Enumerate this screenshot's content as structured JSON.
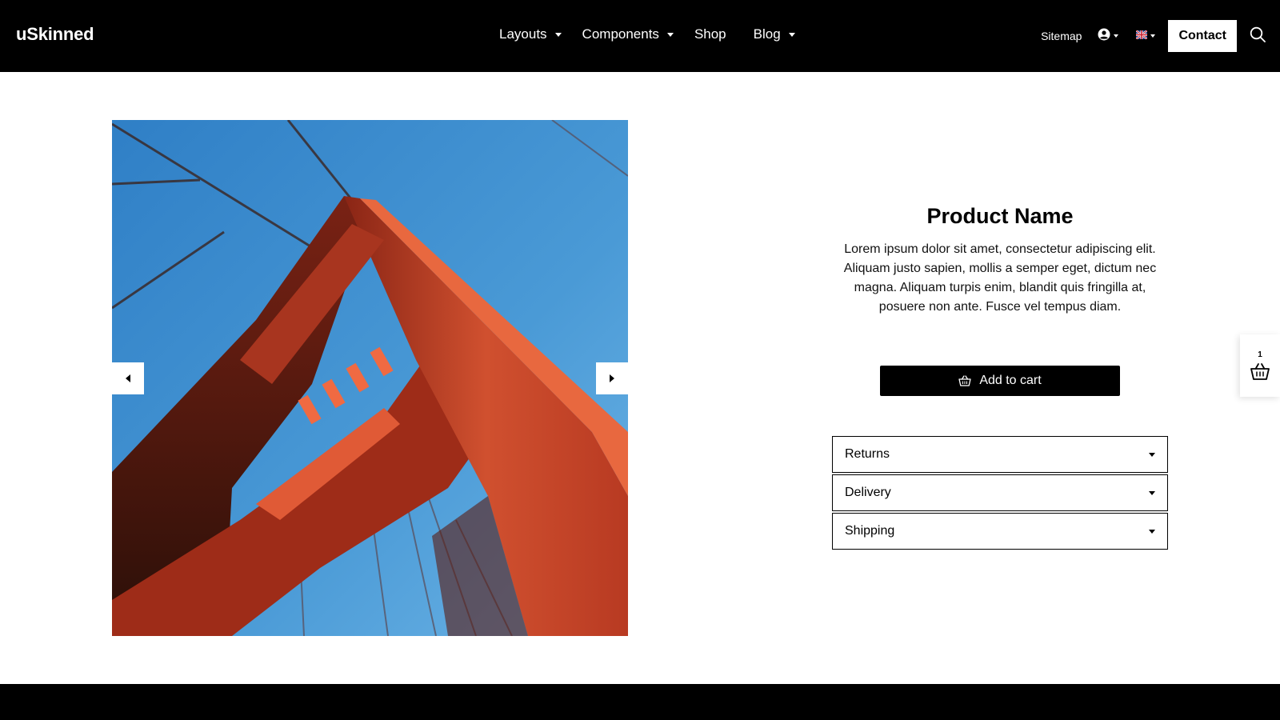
{
  "header": {
    "logo": "uSkinned",
    "nav": [
      {
        "label": "Layouts",
        "has_dropdown": true
      },
      {
        "label": "Components",
        "has_dropdown": true
      },
      {
        "label": "Shop",
        "has_dropdown": false
      },
      {
        "label": "Blog",
        "has_dropdown": true
      }
    ],
    "sitemap": "Sitemap",
    "user_icon": "user-circle-icon",
    "language_icon": "uk-flag-icon",
    "contact": "Contact",
    "search_icon": "search-icon"
  },
  "gallery": {
    "image": "bridge-tower-photo",
    "prev_icon": "caret-left-icon",
    "next_icon": "caret-right-icon"
  },
  "product": {
    "name": "Product Name",
    "description": "Lorem ipsum dolor sit amet, consectetur adipiscing elit. Aliquam justo sapien, mollis a semper eget, dictum nec magna. Aliquam turpis enim, blandit quis fringilla at, posuere non ante. Fusce vel tempus diam.",
    "add_to_cart": "Add to cart",
    "cart_icon": "basket-icon"
  },
  "accordion": [
    {
      "label": "Returns"
    },
    {
      "label": "Delivery"
    },
    {
      "label": "Shipping"
    }
  ],
  "mini_cart": {
    "count": "1",
    "icon": "basket-icon"
  },
  "colors": {
    "header_bg": "#000000",
    "sky": "#4a9ad6",
    "bridge": "#c8442a"
  }
}
